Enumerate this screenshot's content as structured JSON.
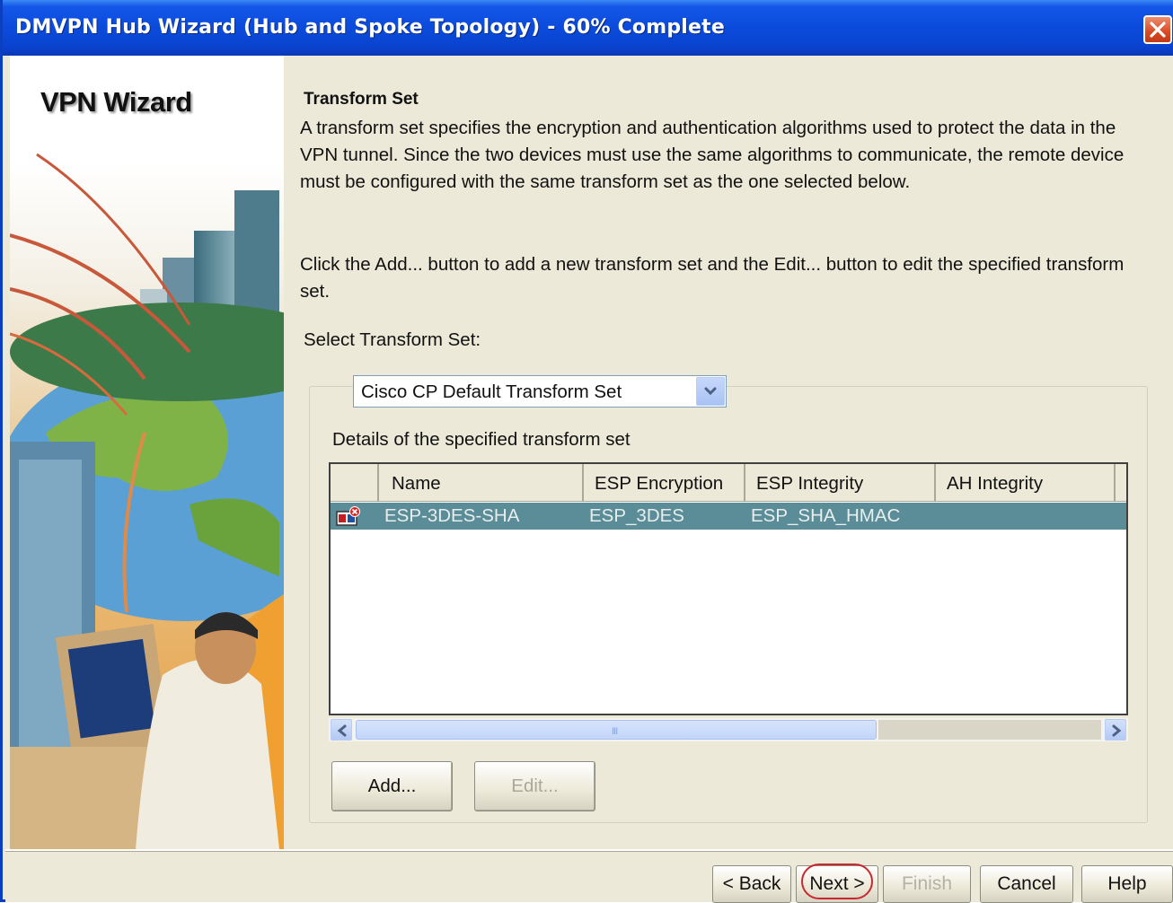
{
  "window": {
    "title": "DMVPN Hub Wizard (Hub and Spoke Topology) - 60% Complete",
    "progress_percent": 60
  },
  "left_panel": {
    "heading": "VPN Wizard"
  },
  "content": {
    "section_title": "Transform Set",
    "description": "A transform set specifies the encryption and authentication algorithms used to protect the data in the VPN tunnel. Since the two devices must use the same algorithms to communicate, the remote device must be configured with the same transform set as the one selected below.",
    "instructions": "Click the Add... button to add a new transform set and the Edit... button to edit the specified transform set.",
    "select_label": "Select Transform Set:",
    "selected_transform_set": "Cisco CP Default Transform Set",
    "details_label": "Details of the specified transform set",
    "table": {
      "columns": [
        "Name",
        "ESP Encryption",
        "ESP Integrity",
        "AH Integrity"
      ],
      "rows": [
        {
          "name": "ESP-3DES-SHA",
          "esp_encryption": "ESP_3DES",
          "esp_integrity": "ESP_SHA_HMAC",
          "ah_integrity": ""
        }
      ]
    },
    "scroll_grip": "III",
    "add_label": "Add...",
    "edit_label": "Edit..."
  },
  "footer": {
    "back_label": "< Back",
    "next_label": "Next >",
    "finish_label": "Finish",
    "cancel_label": "Cancel",
    "help_label": "Help"
  },
  "colors": {
    "title_bar": "#0b4bdc",
    "selected_row": "#5a8d98",
    "next_highlight": "#c8282e"
  }
}
